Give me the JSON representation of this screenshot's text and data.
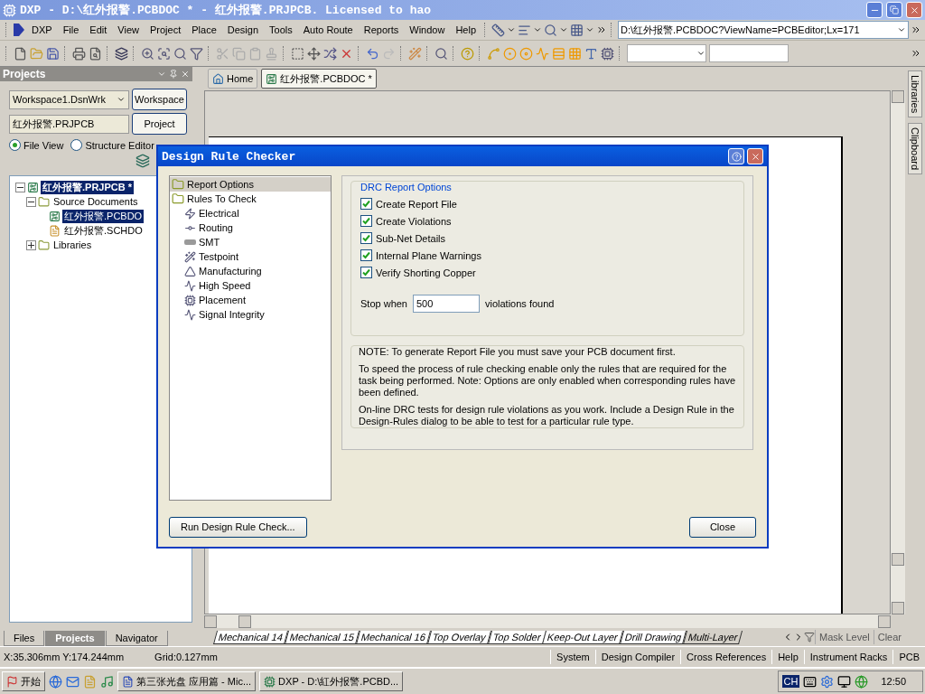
{
  "window": {
    "title": "DXP - D:\\红外报警.PCBDOC * - 红外报警.PRJPCB. Licensed to hao"
  },
  "menu": [
    "DXP",
    "File",
    "Edit",
    "View",
    "Project",
    "Place",
    "Design",
    "Tools",
    "Auto Route",
    "Reports",
    "Window",
    "Help"
  ],
  "address": {
    "value": "D:\\红外报警.PCBDOC?ViewName=PCBEditor;Lx=171"
  },
  "projects_panel": {
    "title": "Projects",
    "workspace": {
      "value": "Workspace1.DsnWrk"
    },
    "workspace_button": "Workspace",
    "project": {
      "value": "红外报警.PRJPCB"
    },
    "project_button": "Project",
    "views": [
      {
        "label": "File View",
        "selected": true
      },
      {
        "label": "Structure Editor",
        "selected": false
      }
    ],
    "tree": [
      {
        "label": "红外报警.PRJPCB *",
        "kind": "project",
        "selected": true,
        "expanded": true,
        "children": [
          {
            "label": "Source Documents",
            "kind": "folder",
            "selected": false,
            "expanded": true,
            "children": [
              {
                "label": "红外报警.PCBDO",
                "kind": "pcb",
                "selected": true
              },
              {
                "label": "红外报警.SCHDO",
                "kind": "schematic",
                "selected": false
              }
            ]
          },
          {
            "label": "Libraries",
            "kind": "folder",
            "selected": false,
            "expanded": false
          }
        ]
      }
    ],
    "tabs": [
      {
        "label": "Files",
        "selected": false
      },
      {
        "label": "Projects",
        "selected": true
      },
      {
        "label": "Navigator",
        "selected": false
      }
    ]
  },
  "document_tabs": [
    {
      "label": "Home",
      "kind": "home",
      "selected": false
    },
    {
      "label": "红外报警.PCBDOC *",
      "kind": "pcb",
      "selected": true
    }
  ],
  "layer_tabs": [
    {
      "label": "Mechanical 14",
      "selected": false
    },
    {
      "label": "Mechanical 15",
      "selected": false
    },
    {
      "label": "Mechanical 16",
      "selected": false
    },
    {
      "label": "Top Overlay",
      "selected": false
    },
    {
      "label": "Top Solder",
      "selected": false
    },
    {
      "label": "Keep-Out Layer",
      "selected": false
    },
    {
      "label": "Drill Drawing",
      "selected": false
    },
    {
      "label": "Multi-Layer",
      "selected": true
    }
  ],
  "layer_buttons": [
    "Mask Level",
    "Clear"
  ],
  "side_tabs": [
    "Libraries",
    "Clipboard"
  ],
  "dialog": {
    "title": "Design Rule Checker",
    "tree": [
      {
        "label": "Report Options",
        "selected": true
      },
      {
        "label": "Rules To Check",
        "selected": false,
        "children": [
          {
            "label": "Electrical"
          },
          {
            "label": "Routing"
          },
          {
            "label": "SMT"
          },
          {
            "label": "Testpoint"
          },
          {
            "label": "Manufacturing"
          },
          {
            "label": "High Speed"
          },
          {
            "label": "Placement"
          },
          {
            "label": "Signal Integrity"
          }
        ]
      }
    ],
    "group_title": "DRC Report Options",
    "options": [
      {
        "label": "Create Report File",
        "checked": true
      },
      {
        "label": "Create Violations",
        "checked": true
      },
      {
        "label": "Sub-Net Details",
        "checked": true
      },
      {
        "label": "Internal Plane Warnings",
        "checked": true
      },
      {
        "label": "Verify Shorting Copper",
        "checked": true
      }
    ],
    "stop_label": "Stop when",
    "stop_value": "500",
    "stop_suffix": "violations found",
    "notes": [
      "NOTE: To generate Report File you must save your PCB document first.",
      "To speed the process of rule checking enable only the rules that are required for the task being performed.  Note: Options are only enabled when corresponding rules have been defined.",
      "On-line DRC tests for design rule violations as you work. Include a Design Rule in the Design-Rules dialog to be able to test for a particular rule  type."
    ],
    "run_button": "Run Design Rule Check...",
    "close_button": "Close"
  },
  "status_bar": {
    "position": "X:35.306mm Y:174.244mm",
    "grid": "Grid:0.127mm",
    "panels": [
      "System",
      "Design Compiler",
      "Cross References",
      "Help",
      "Instrument Racks",
      "PCB"
    ]
  },
  "taskbar": {
    "start": "开始",
    "tasks": [
      "第三张光盘 应用篇 - Mic...",
      "DXP - D:\\紅外报警.PCBD..."
    ],
    "language": "CH",
    "clock": "12:50"
  }
}
